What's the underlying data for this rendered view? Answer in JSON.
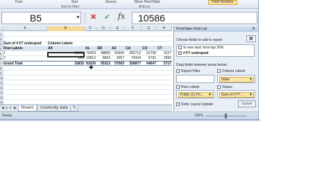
{
  "ribbon": {
    "font_label": "Font",
    "sort_label": "Sort",
    "source_label": "Source",
    "move_label": "Move PivotTable",
    "group_sort_filter": "Sort & Filter",
    "group_actions": "Actions",
    "find_headers": "Field Headers"
  },
  "formula_bar": {
    "name_box": "B5",
    "formula": "10586",
    "fx": "fx",
    "cancel": "✖",
    "enter": "✔"
  },
  "grid": {
    "columns": [
      "A",
      "B",
      "C",
      "D",
      "E",
      "F",
      "G",
      "H"
    ],
    "row_numbers": [
      "1",
      "2",
      "3",
      "4",
      "5",
      "6",
      "7",
      "8",
      "9",
      "10",
      "11",
      "12",
      "13",
      "14",
      "15",
      "16"
    ],
    "rows": [
      {
        "a": "",
        "b": "",
        "c": "",
        "d": "",
        "e": "",
        "f": "",
        "g": "",
        "h": ""
      },
      {
        "a": "",
        "b": "",
        "c": "",
        "d": "",
        "e": "",
        "f": "",
        "g": "",
        "h": ""
      },
      {
        "a": "Sum of # FT undergrad",
        "b": "Column Labels",
        "c": "",
        "d": "",
        "e": "",
        "f": "",
        "g": "",
        "h": ""
      },
      {
        "a": "Row Labels",
        "b": "AK",
        "c": "AL",
        "d": "AR",
        "e": "AZ",
        "f": "CA",
        "g": "CO",
        "h": "CT"
      },
      {
        "a": "1",
        "b": "10586",
        "c": "70418",
        "d": "48850",
        "e": "55506",
        "f": "282713",
        "g": "61736",
        "h": "3127"
      },
      {
        "a": "2",
        "b": "249",
        "c": "15812",
        "d": "8663",
        "e": "2057",
        "f": "74164",
        "g": "6791",
        "h": "2590"
      },
      {
        "a": "Grand Total",
        "b": "10835",
        "c": "91630",
        "d": "55313",
        "e": "57563",
        "f": "356877",
        "g": "64647",
        "h": "5717"
      },
      {
        "a": "",
        "b": "",
        "c": "",
        "d": "",
        "e": "",
        "f": "",
        "g": "",
        "h": ""
      },
      {
        "a": "",
        "b": "",
        "c": "",
        "d": "",
        "e": "",
        "f": "",
        "g": "",
        "h": ""
      },
      {
        "a": "",
        "b": "",
        "c": "",
        "d": "",
        "e": "",
        "f": "",
        "g": "",
        "h": ""
      },
      {
        "a": "",
        "b": "",
        "c": "",
        "d": "",
        "e": "",
        "f": "",
        "g": "",
        "h": ""
      },
      {
        "a": "",
        "b": "",
        "c": "",
        "d": "",
        "e": "",
        "f": "",
        "g": "",
        "h": ""
      },
      {
        "a": "",
        "b": "",
        "c": "",
        "d": "",
        "e": "",
        "f": "",
        "g": "",
        "h": ""
      },
      {
        "a": "",
        "b": "",
        "c": "",
        "d": "",
        "e": "",
        "f": "",
        "g": "",
        "h": ""
      },
      {
        "a": "",
        "b": "",
        "c": "",
        "d": "",
        "e": "",
        "f": "",
        "g": "",
        "h": ""
      },
      {
        "a": "",
        "b": "",
        "c": "",
        "d": "",
        "e": "",
        "f": "",
        "g": "",
        "h": ""
      }
    ]
  },
  "sheet_tabs": {
    "tabs": [
      "Sheet1",
      "University data"
    ]
  },
  "status": {
    "ready": "Ready",
    "zoom": "100%"
  },
  "pivot_pane": {
    "title": "PivotTable Field List",
    "close": "✕",
    "choose_label": "Choose fields to add to report:",
    "fields": [
      {
        "label": "% new stud. from top 25%",
        "checked": false
      },
      {
        "label": "# FT undergrad",
        "checked": true
      }
    ],
    "drag_label": "Drag fields between areas below:",
    "report_filter": "Report Filter",
    "column_labels": "Column Labels",
    "column_value": "State",
    "row_labels": "Row Labels",
    "values": "Values",
    "row_value": "Public (1) Pri...",
    "values_value": "Sum of # FT ...",
    "defer": "Defer Layout Update",
    "update": "Update"
  }
}
